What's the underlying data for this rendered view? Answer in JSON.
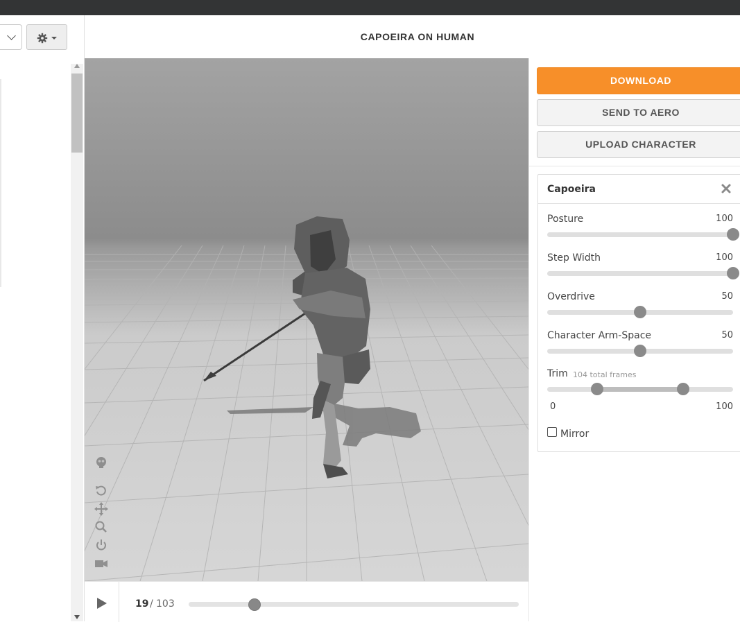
{
  "header": {
    "title": "CAPOEIRA ON HUMAN"
  },
  "left_panel": {
    "settings_icon": "gear-icon"
  },
  "viewport": {
    "tools": [
      "skeleton-icon",
      "reset-view-icon",
      "pan-icon",
      "zoom-icon",
      "power-icon",
      "camera-icon"
    ]
  },
  "playback": {
    "current_frame": "19",
    "separator": "/",
    "total_frames": "103",
    "progress": 0.2
  },
  "actions": {
    "download": "DOWNLOAD",
    "send_to_aero": "SEND TO AERO",
    "upload_character": "UPLOAD CHARACTER"
  },
  "animation_panel": {
    "title": "Capoeira",
    "params": [
      {
        "label": "Posture",
        "value": "100",
        "fraction": 1.0
      },
      {
        "label": "Step Width",
        "value": "100",
        "fraction": 1.0
      },
      {
        "label": "Overdrive",
        "value": "50",
        "fraction": 0.5
      },
      {
        "label": "Character Arm-Space",
        "value": "50",
        "fraction": 0.5
      }
    ],
    "trim": {
      "label": "Trim",
      "note": "104 total frames",
      "min_label": "0",
      "max_label": "100",
      "start_fraction": 0.27,
      "end_fraction": 0.73
    },
    "mirror": {
      "label": "Mirror",
      "checked": false
    }
  },
  "colors": {
    "accent": "#f78f29",
    "dark_bar": "#333435"
  }
}
